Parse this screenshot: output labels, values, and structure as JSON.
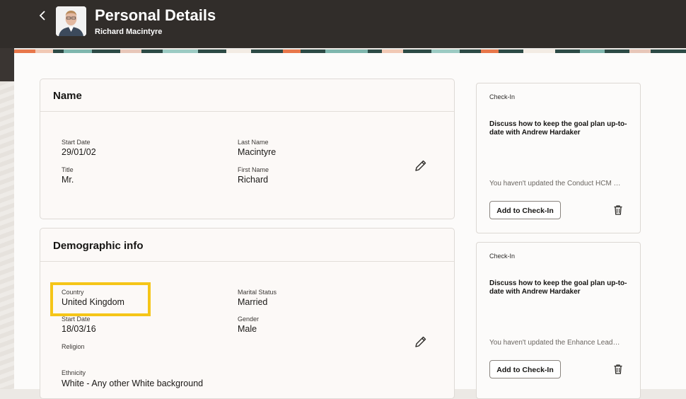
{
  "header": {
    "title": "Personal Details",
    "subtitle": "Richard Macintyre"
  },
  "name_card": {
    "title": "Name",
    "fields": {
      "start_date_label": "Start Date",
      "start_date": "29/01/02",
      "title_label": "Title",
      "title": "Mr.",
      "last_name_label": "Last Name",
      "last_name": "Macintyre",
      "first_name_label": "First Name",
      "first_name": "Richard"
    }
  },
  "demo_card": {
    "title": "Demographic info",
    "fields": {
      "country_label": "Country",
      "country": "United Kingdom",
      "start_date_label": "Start Date",
      "start_date": "18/03/16",
      "religion_label": "Religion",
      "ethnicity_label": "Ethnicity",
      "ethnicity": "White - Any other White background",
      "marital_label": "Marital Status",
      "marital": "Married",
      "gender_label": "Gender",
      "gender": "Male"
    }
  },
  "checkins": [
    {
      "label": "Check-In",
      "heading": "Discuss how to keep the goal plan up-to-date with Andrew Hardaker",
      "text": "You haven't updated the Conduct HCM …",
      "button": "Add to Check-In"
    },
    {
      "label": "Check-In",
      "heading": "Discuss how to keep the goal plan up-to-date with Andrew Hardaker",
      "text": "You haven't updated the Enhance Lead…",
      "button": "Add to Check-In"
    }
  ],
  "colors": {
    "header_bg": "#312d2a",
    "highlight": "#f5c518"
  }
}
